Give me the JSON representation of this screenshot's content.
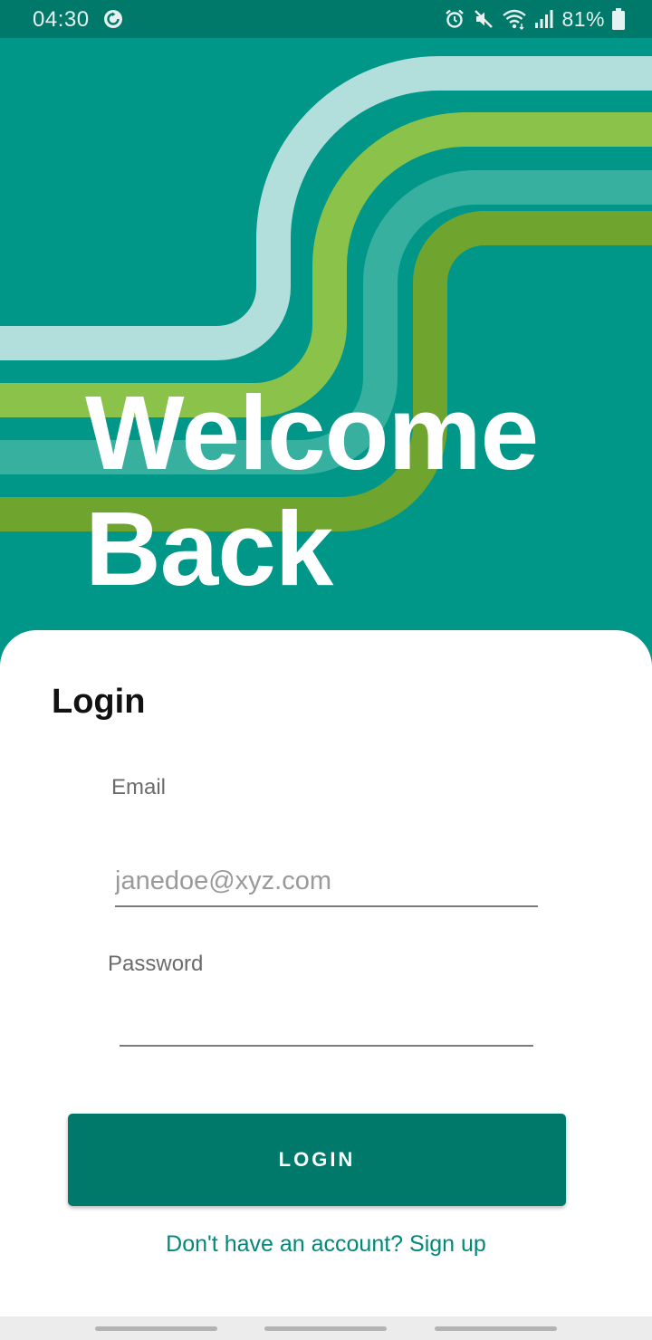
{
  "status_bar": {
    "time": "04:30",
    "battery_percent": "81%",
    "icons": [
      "sync-icon",
      "alarm-icon",
      "mute-icon",
      "wifi-icon",
      "signal-icon",
      "battery-icon"
    ]
  },
  "hero": {
    "title_line1": "Welcome",
    "title_line2": "Back",
    "colors": {
      "background": "#009688",
      "stripe_light": "#b2dfdb",
      "stripe_green": "#8bc34a",
      "stripe_teal": "#38b0a0",
      "stripe_olive": "#6fa52f"
    }
  },
  "login_form": {
    "heading": "Login",
    "email_label": "Email",
    "email_placeholder": "janedoe@xyz.com",
    "email_value": "",
    "password_label": "Password",
    "password_value": "",
    "submit_label": "LOGIN",
    "signup_link": "Don't have an account? Sign up"
  },
  "theme": {
    "primary": "#00796b",
    "accent_text": "#00897b"
  }
}
